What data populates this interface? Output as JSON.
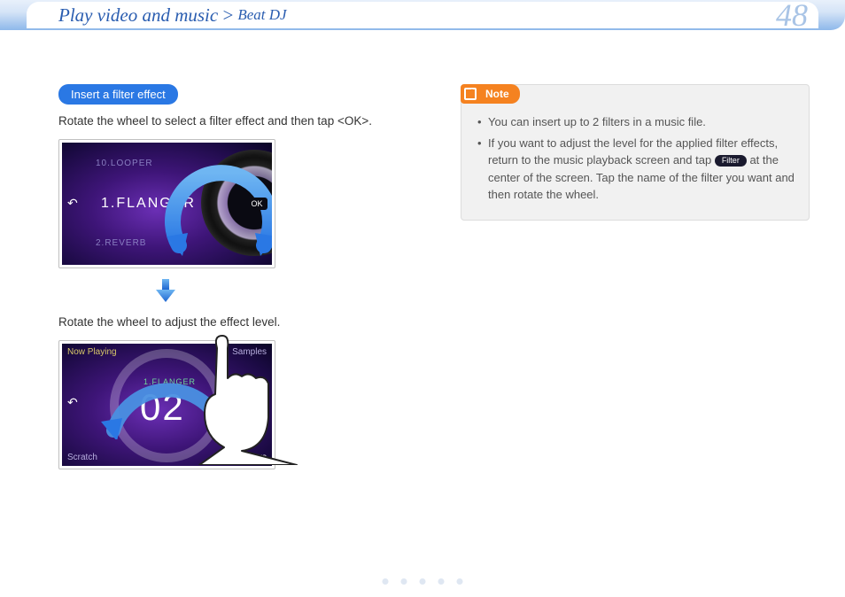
{
  "header": {
    "breadcrumb_main": "Play video and music",
    "breadcrumb_sep": ">",
    "breadcrumb_sub": "Beat DJ",
    "page_number": "48"
  },
  "left": {
    "subhead": "Insert a filter effect",
    "instr1": "Rotate the wheel to select a filter effect and then tap <OK>.",
    "instr2": "Rotate the wheel to adjust the effect level.",
    "screen1": {
      "top_option": "10.LOOPER",
      "main_option": "1.FLANGER",
      "bottom_option": "2.REVERB",
      "ok": "OK"
    },
    "screen2": {
      "tl": "Now Playing",
      "tr": "Samples",
      "bl": "Scratch",
      "br": "Filters",
      "label": "1.FLANGER",
      "value": "02"
    }
  },
  "note": {
    "label": "Note",
    "item1": "You can insert up to 2 filters in a music file.",
    "item2_a": "If you want to adjust the level for the applied filter effects, return to the music playback screen and tap ",
    "item2_pill": "Filter",
    "item2_b": " at the center of the screen. Tap the name of the filter you want and then rotate the wheel."
  }
}
